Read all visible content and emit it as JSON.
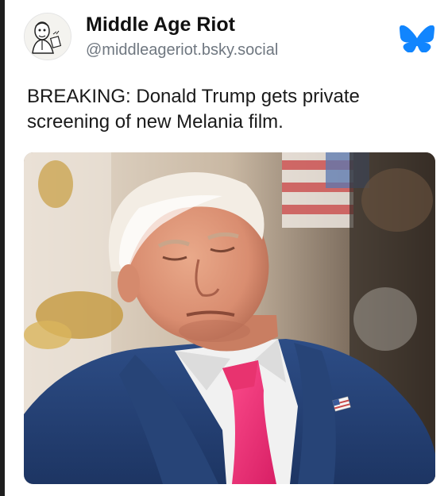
{
  "post": {
    "author_name": "Middle Age Riot",
    "author_handle": "@middleageriot.bsky.social",
    "text": "BREAKING: Donald Trump gets private screening of new Melania film."
  },
  "icons": {
    "avatar": "caricature-avatar",
    "platform": "butterfly-icon"
  },
  "colors": {
    "brand_blue": "#1185fe",
    "handle_gray": "#6f7780",
    "text": "#1a1a1a"
  }
}
